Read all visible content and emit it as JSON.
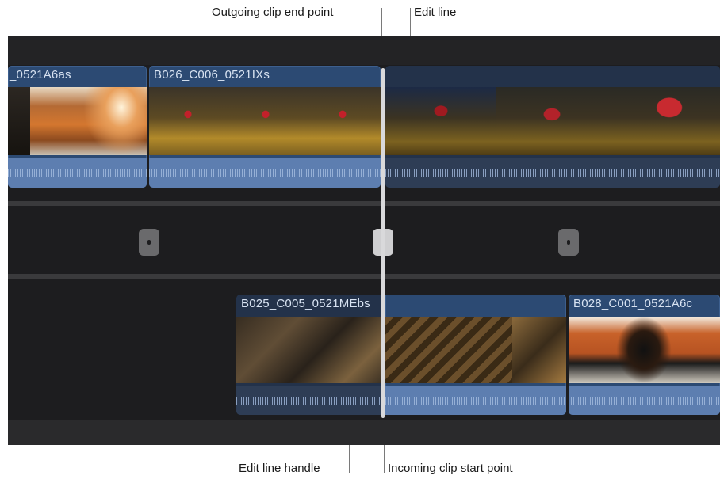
{
  "callouts": {
    "outgoing_end": "Outgoing clip end point",
    "edit_line": "Edit line",
    "edit_line_handle": "Edit line handle",
    "incoming_start": "Incoming clip start point"
  },
  "timeline": {
    "upper_clips": [
      {
        "name": "_0521A6as"
      },
      {
        "name": "B026_C006_0521IXs"
      }
    ],
    "lower_clips": [
      {
        "name": "B025_C005_0521MEbs"
      },
      {
        "name": "B028_C001_0521A6c"
      }
    ]
  },
  "colors": {
    "timeline_bg": "#1d1d1f",
    "clip_blue": "#2c4a73",
    "audio_blue": "#5d7eb0",
    "orange_tunnel": "#c8622a"
  }
}
